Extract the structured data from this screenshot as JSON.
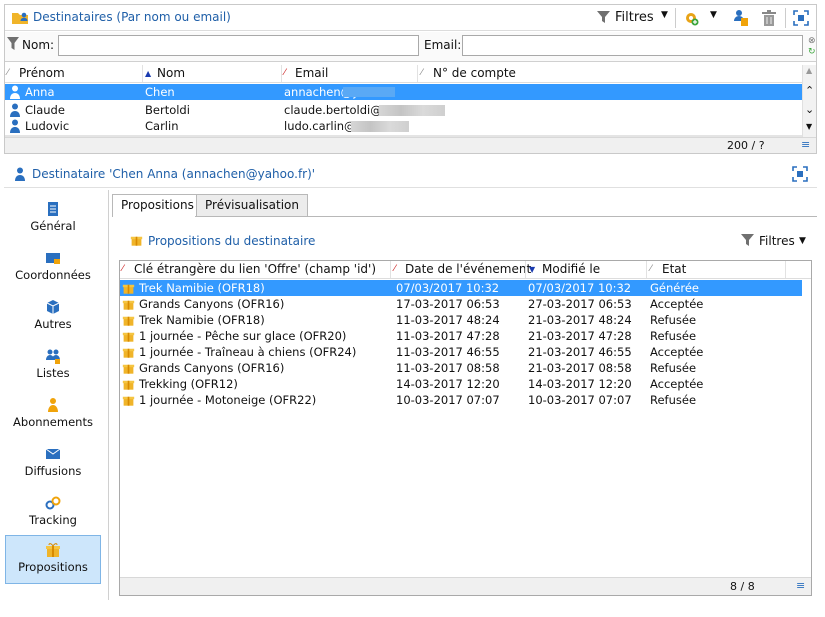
{
  "top": {
    "title": "Destinataires (Par nom ou email)",
    "filters_label": "Filtres",
    "name_label": "Nom:",
    "name_value": "",
    "email_label": "Email:",
    "email_value": "",
    "columns": [
      "Prénom",
      "Nom",
      "Email",
      "N° de compte"
    ],
    "rows": [
      {
        "first": "Anna",
        "last": "Chen",
        "email": "annachen@y"
      },
      {
        "first": "Claude",
        "last": "Bertoldi",
        "email": "claude.bertoldi@"
      },
      {
        "first": "Ludovic",
        "last": "Carlin",
        "email": "ludo.carlin@"
      }
    ],
    "count": "200 / ?"
  },
  "detail": {
    "title": "Destinataire 'Chen Anna (annachen@yahoo.fr)'",
    "nav": [
      "Général",
      "Coordonnées",
      "Autres",
      "Listes",
      "Abonnements",
      "Diffusions",
      "Tracking",
      "Propositions"
    ],
    "tabs": [
      "Propositions",
      "Prévisualisation"
    ],
    "section_title": "Propositions du destinataire",
    "filters_label": "Filtres",
    "columns": [
      "Clé étrangère du lien 'Offre' (champ 'id')",
      "Date de l'événement",
      "Modifié le",
      "Etat"
    ],
    "rows": [
      {
        "offer": "Trek Namibie (OFR18)",
        "event": "07/03/2017 10:32",
        "modified": "07/03/2017 10:32",
        "state": "Générée"
      },
      {
        "offer": "Grands Canyons (OFR16)",
        "event": "17-03-2017 06:53",
        "modified": "27-03-2017 06:53",
        "state": "Acceptée"
      },
      {
        "offer": "Trek Namibie (OFR18)",
        "event": "11-03-2017 48:24",
        "modified": "21-03-2017 48:24",
        "state": "Refusée"
      },
      {
        "offer": "1 journée - Pêche sur glace (OFR20)",
        "event": "11-03-2017 47:28",
        "modified": "21-03-2017 47:28",
        "state": "Refusée"
      },
      {
        "offer": "1 journée - Traîneau à chiens (OFR24)",
        "event": "11-03-2017 46:55",
        "modified": "21-03-2017 46:55",
        "state": "Acceptée"
      },
      {
        "offer": "Grands Canyons (OFR16)",
        "event": "11-03-2017 08:58",
        "modified": "21-03-2017 08:58",
        "state": "Refusée"
      },
      {
        "offer": "Trekking (OFR12)",
        "event": "14-03-2017 12:20",
        "modified": "14-03-2017 12:20",
        "state": "Acceptée"
      },
      {
        "offer": "1 journée - Motoneige (OFR22)",
        "event": "10-03-2017 07:07",
        "modified": "10-03-2017 07:07",
        "state": "Refusée"
      }
    ],
    "count": "8 / 8"
  },
  "colors": {
    "accent": "#3399ff",
    "title_blue": "#1f5fa8",
    "icon_orange": "#f0a30a",
    "nav_selected": "#cde6fb"
  }
}
